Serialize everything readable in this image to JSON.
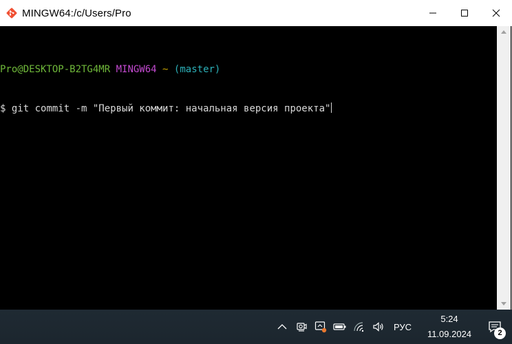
{
  "window": {
    "title": "MINGW64:/c/Users/Pro",
    "controls": [
      "minimize-icon",
      "maximize-icon",
      "close-icon"
    ]
  },
  "terminal": {
    "prompt": {
      "user_host": "Pro@DESKTOP-B2TG4MR",
      "env": "MINGW64",
      "path": "~",
      "branch": "(master)"
    },
    "command_line": {
      "symbol": "$",
      "command": "git commit -m \"Первый коммит: начальная версия проекта\""
    },
    "colors": {
      "user_host": "#6fb83a",
      "env": "#c34ad0",
      "path": "#c6a200",
      "branch": "#2cb0b8",
      "text": "#d8d8d8",
      "background": "#000000"
    }
  },
  "taskbar": {
    "tray_icons": [
      "chevron-up-icon",
      "camera-icon",
      "app-tray-icon",
      "battery-icon",
      "wifi-icon",
      "volume-icon"
    ],
    "language": "РУС",
    "time": "5:24",
    "date": "11.09.2024",
    "notifications_count": "2"
  }
}
